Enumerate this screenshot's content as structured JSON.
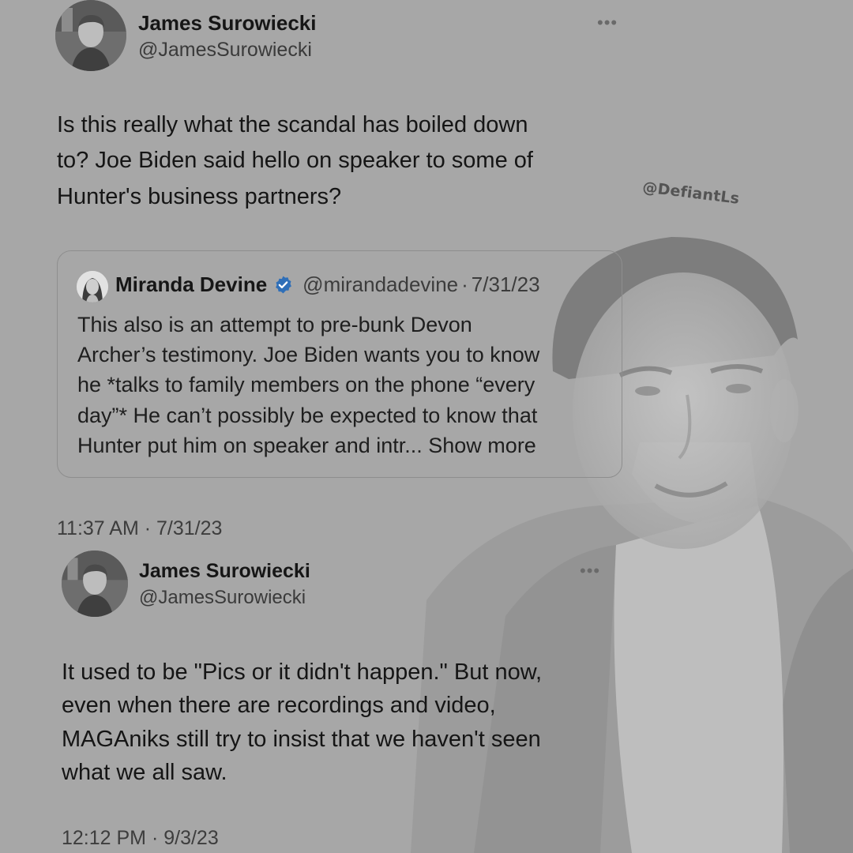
{
  "watermark": "@DefiantLs",
  "tweet1": {
    "name": "James Surowiecki",
    "handle": "@JamesSurowiecki",
    "more_icon": "ellipsis-icon",
    "text_lines": [
      "Is this really what the scandal has boiled down",
      "to? Joe Biden said hello on speaker to some of",
      "Hunter's business partners?"
    ],
    "quote": {
      "name": "Miranda Devine",
      "verified_icon": "verified-badge-icon",
      "verified_color": "#2f6fb8",
      "handle": "@mirandadevine",
      "separator": "·",
      "date": "7/31/23",
      "text_lines": [
        "This also is an attempt to pre-bunk Devon",
        "Archer’s testimony. Joe Biden wants you to know",
        "he *talks to family members on the phone “every",
        "day”* He can’t possibly be expected to know that",
        "Hunter put him on speaker and intr..."
      ],
      "show_more": "Show more"
    },
    "timestamp": "11:37 AM · 7/31/23"
  },
  "tweet2": {
    "name": "James Surowiecki",
    "handle": "@JamesSurowiecki",
    "more_icon": "ellipsis-icon",
    "text_lines": [
      "It used to be \"Pics or it didn't happen.\" But now,",
      "even when there are recordings and video,",
      "MAGAniks still try to insist that we haven't seen",
      "what we all saw."
    ],
    "timestamp": "12:12 PM · 9/3/23"
  },
  "colors": {
    "background": "#a7a7a7",
    "text": "#151515",
    "secondary_text": "#3a3a3a",
    "card_border": "#8e8e8e"
  }
}
